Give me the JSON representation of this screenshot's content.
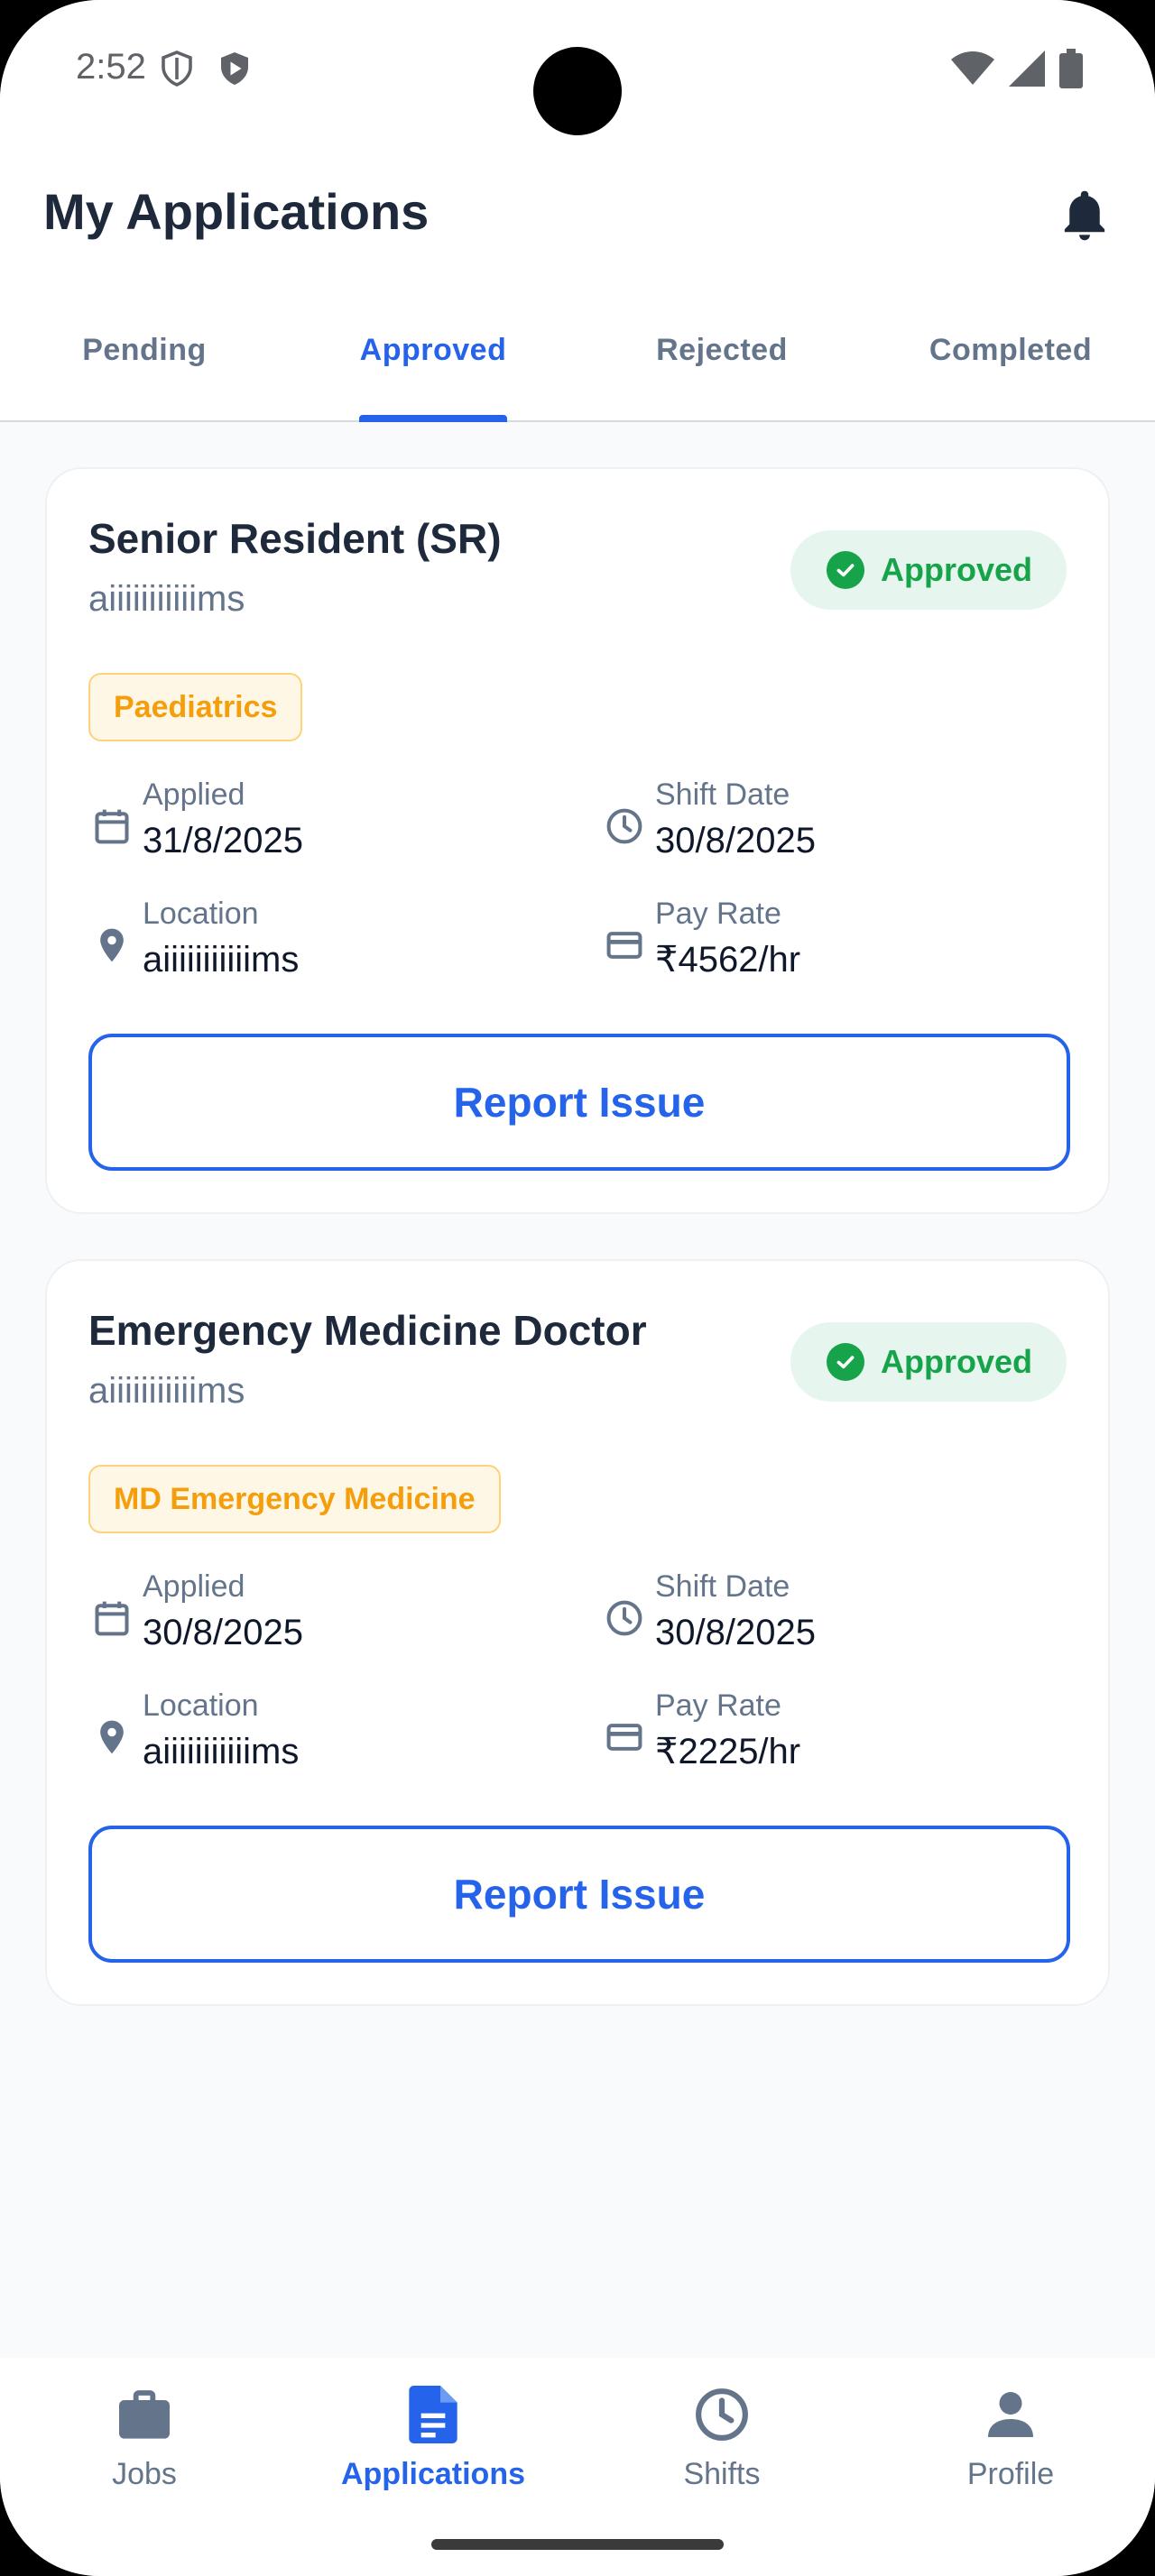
{
  "status_bar": {
    "time": "2:52"
  },
  "header": {
    "title": "My Applications"
  },
  "tabs": [
    {
      "label": "Pending",
      "active": false
    },
    {
      "label": "Approved",
      "active": true
    },
    {
      "label": "Rejected",
      "active": false
    },
    {
      "label": "Completed",
      "active": false
    }
  ],
  "cards": [
    {
      "title": "Senior Resident (SR)",
      "organization": "aiiiiiiiiiiims",
      "status": "Approved",
      "specialty": "Paediatrics",
      "applied_label": "Applied",
      "applied": "31/8/2025",
      "shift_label": "Shift Date",
      "shift_date": "30/8/2025",
      "location_label": "Location",
      "location": "aiiiiiiiiiiims",
      "pay_label": "Pay Rate",
      "pay_rate": "₹4562/hr",
      "action": "Report Issue"
    },
    {
      "title": "Emergency Medicine Doctor",
      "organization": "aiiiiiiiiiiims",
      "status": "Approved",
      "specialty": "MD Emergency Medicine",
      "applied_label": "Applied",
      "applied": "30/8/2025",
      "shift_label": "Shift Date",
      "shift_date": "30/8/2025",
      "location_label": "Location",
      "location": "aiiiiiiiiiiims",
      "pay_label": "Pay Rate",
      "pay_rate": "₹2225/hr",
      "action": "Report Issue"
    }
  ],
  "bottom_nav": [
    {
      "label": "Jobs",
      "icon": "briefcase-icon",
      "active": false
    },
    {
      "label": "Applications",
      "icon": "document-icon",
      "active": true
    },
    {
      "label": "Shifts",
      "icon": "clock-icon",
      "active": false
    },
    {
      "label": "Profile",
      "icon": "person-icon",
      "active": false
    }
  ],
  "colors": {
    "accent": "#2563eb",
    "approved": "#16a34a",
    "tag": "#f59e0b",
    "title": "#1e293b"
  }
}
